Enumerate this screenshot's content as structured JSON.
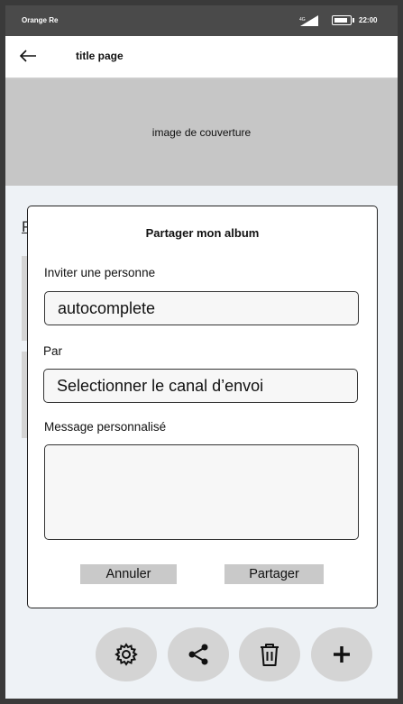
{
  "status_bar": {
    "carrier": "Orange Re",
    "network": "4G",
    "time": "22:00"
  },
  "app_bar": {
    "back_icon": "arrow-left-icon",
    "title": "title page"
  },
  "cover": {
    "label": "image de couverture"
  },
  "background_peek": {
    "letter": "P"
  },
  "dialog": {
    "title": "Partager mon album",
    "invite_label": "Inviter une personne",
    "invite_value": "autocomplete",
    "channel_label": "Par",
    "channel_value": "Selectionner le canal d’envoi",
    "message_label": "Message personnalisé",
    "message_value": "",
    "cancel_label": "Annuler",
    "share_label": "Partager"
  },
  "actions": [
    {
      "icon": "gear-icon"
    },
    {
      "icon": "share-icon"
    },
    {
      "icon": "trash-icon"
    },
    {
      "icon": "plus-icon"
    }
  ]
}
